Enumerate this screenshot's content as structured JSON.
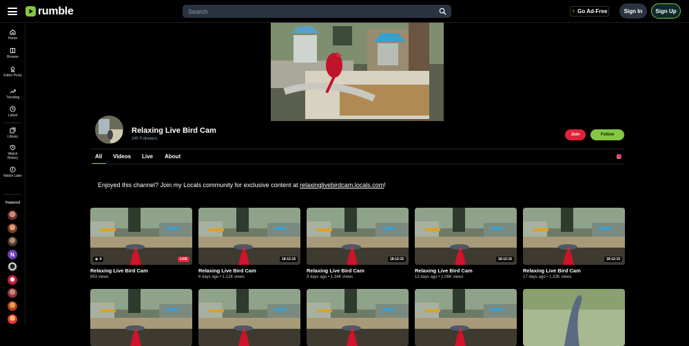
{
  "header": {
    "logo_text": "rumble",
    "search_placeholder": "Search",
    "go_ad_free": "Go Ad-Free",
    "sign_in": "Sign In",
    "sign_up": "Sign Up"
  },
  "sidebar": {
    "items": [
      {
        "label": "Home",
        "icon": "home-icon"
      },
      {
        "label": "Browse",
        "icon": "browse-icon"
      },
      {
        "label": "Editor Picks",
        "icon": "editor-picks-icon"
      },
      {
        "label": "Trending",
        "icon": "trending-icon"
      },
      {
        "label": "Latest",
        "icon": "clock-icon"
      },
      {
        "label": "Library",
        "icon": "library-icon"
      },
      {
        "label": "Watch History",
        "icon": "history-icon"
      },
      {
        "label": "Watch Later",
        "icon": "watch-later-icon"
      }
    ],
    "featured_label": "Featured"
  },
  "channel": {
    "name": "Relaxing Live Bird Cam",
    "followers": "245 Followers",
    "join": "Join",
    "follow": "Follow"
  },
  "tabs": [
    {
      "label": "All",
      "active": true
    },
    {
      "label": "Videos",
      "active": false
    },
    {
      "label": "Live",
      "active": false
    },
    {
      "label": "About",
      "active": false
    }
  ],
  "about": {
    "text": "Enjoyed this channel? Join my Locals community for exclusive content at ",
    "link": "relaxinglivebirdcam.locals.com",
    "suffix": "!"
  },
  "videos": [
    {
      "title": "Relaxing Live Bird Cam",
      "meta": "953 views",
      "badge": "LIVE",
      "viewers": "4"
    },
    {
      "title": "Relaxing Live Bird Cam",
      "meta": "6 days ago • 1.12K views",
      "badge": "18:12:15"
    },
    {
      "title": "Relaxing Live Bird Cam",
      "meta": "9 days ago • 1.34K views",
      "badge": "18:12:15"
    },
    {
      "title": "Relaxing Live Bird Cam",
      "meta": "13 days ago • 1.06K views",
      "badge": "18:12:15"
    },
    {
      "title": "Relaxing Live Bird Cam",
      "meta": "17 days ago • 1.32K views",
      "badge": "18:12:15"
    }
  ]
}
